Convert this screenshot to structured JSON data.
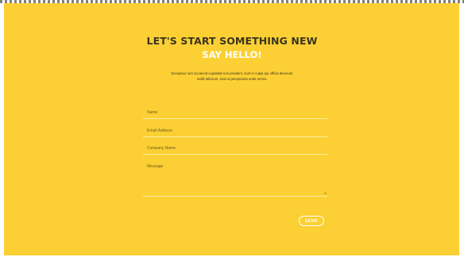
{
  "contact": {
    "heading": "LET'S START SOMETHING NEW",
    "subheading": "SAY HELLO!",
    "intro_line1": "Excepteur sint occaecat cupidatat non proident, sunt in culpa qui officia deserunt",
    "intro_line2": "mollit laborum. Sed ut perspiciatis unde omnis.",
    "form": {
      "name_placeholder": "Name",
      "email_placeholder": "Email Address",
      "company_placeholder": "Company Name",
      "message_placeholder": "Message",
      "send_label": "SEND"
    }
  },
  "colors": {
    "background": "#fcd034",
    "heading": "#3a3420",
    "accent_text": "#ffffff"
  }
}
